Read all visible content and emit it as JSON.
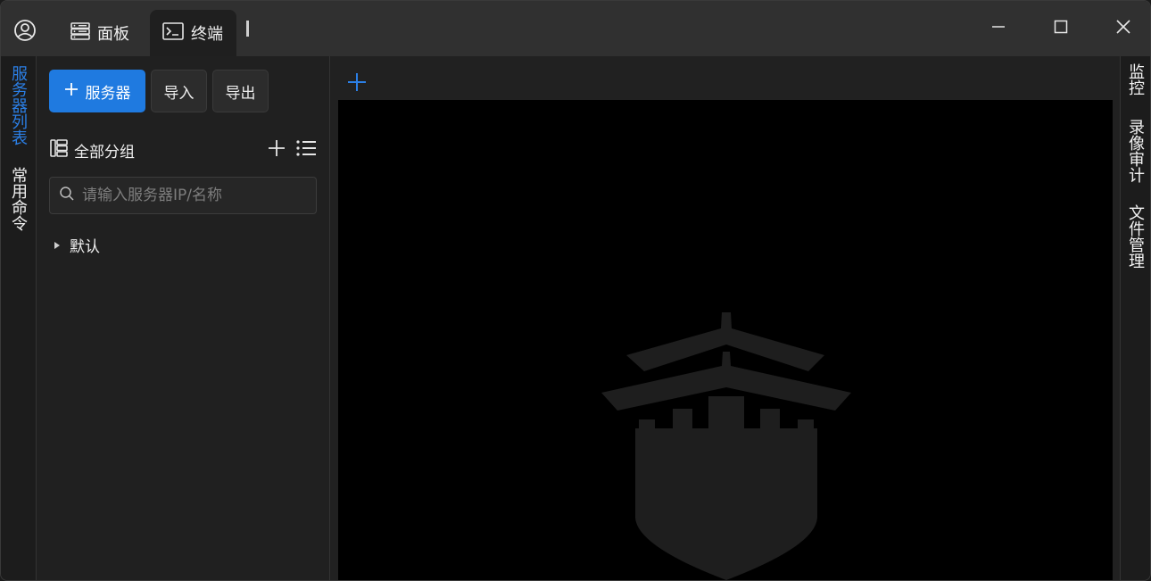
{
  "titlebar": {
    "tabs": [
      {
        "label": "面板",
        "icon": "server-icon"
      },
      {
        "label": "终端",
        "icon": "terminal-icon"
      }
    ],
    "divider": "|",
    "window_controls": [
      "minimize-icon",
      "maximize-icon",
      "close-icon"
    ]
  },
  "left_rail": {
    "items": [
      {
        "label": "服务器列表",
        "active": true
      },
      {
        "label": "常用命令",
        "active": false
      }
    ]
  },
  "server_panel": {
    "add_server_label": "服务器",
    "import_label": "导入",
    "export_label": "导出",
    "group_title": "全部分组",
    "search_placeholder": "请输入服务器IP/名称",
    "tree": [
      {
        "label": "默认",
        "expanded": false
      }
    ]
  },
  "right_rail": {
    "items": [
      {
        "label": "监控"
      },
      {
        "label": "录像审计"
      },
      {
        "label": "文件管理"
      }
    ]
  },
  "colors": {
    "accent": "#1f7ae0",
    "active_label": "#2b7fe6",
    "terminal_bg": "#000000",
    "logo": "#1e1e1e"
  }
}
